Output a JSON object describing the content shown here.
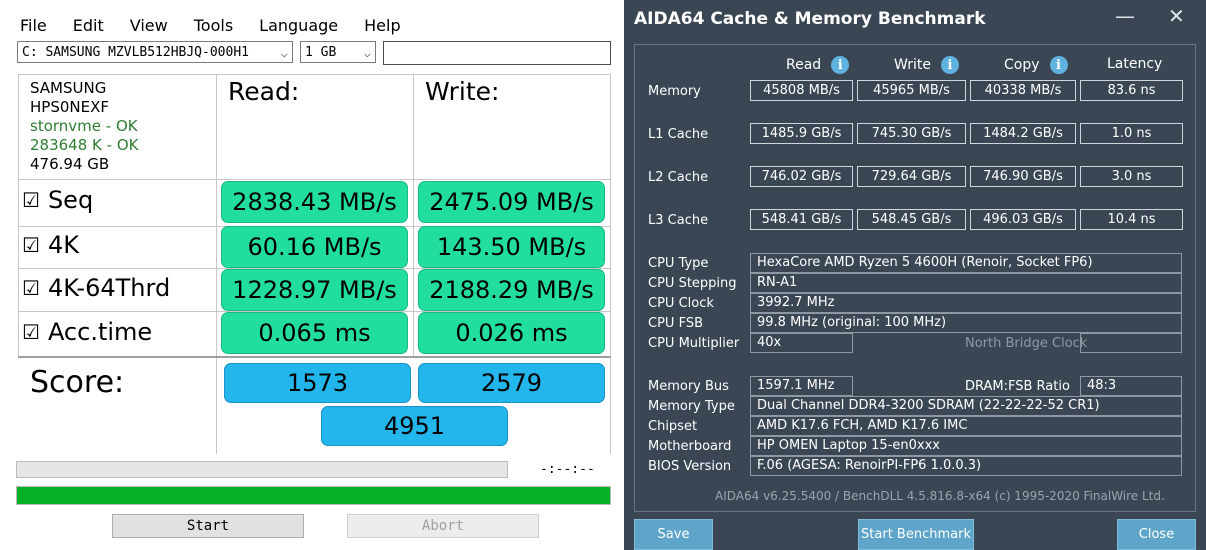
{
  "asssd": {
    "menu": [
      "File",
      "Edit",
      "View",
      "Tools",
      "Language",
      "Help"
    ],
    "drive_select": "C: SAMSUNG MZVLB512HBJQ-000H1",
    "size_select": "1 GB",
    "text_field": "",
    "drive_info": {
      "vendor": "SAMSUNG",
      "firmware": "HPS0NEXF",
      "driver": "stornvme - OK",
      "alignment": "283648 K - OK",
      "capacity": "476.94 GB"
    },
    "col_read": "Read:",
    "col_write": "Write:",
    "rows": [
      {
        "label": "Seq",
        "read": "2838.43 MB/s",
        "write": "2475.09 MB/s",
        "checked": true
      },
      {
        "label": "4K",
        "read": "60.16 MB/s",
        "write": "143.50 MB/s",
        "checked": true
      },
      {
        "label": "4K-64Thrd",
        "read": "1228.97 MB/s",
        "write": "2188.29 MB/s",
        "checked": true
      },
      {
        "label": "Acc.time",
        "read": "0.065 ms",
        "write": "0.026 ms",
        "checked": true
      }
    ],
    "check_glyph": "☑",
    "score_label": "Score:",
    "score_read": "1573",
    "score_write": "2579",
    "score_total": "4951",
    "elapsed": "-:--:--",
    "progress_fraction": 1.0,
    "start_label": "Start",
    "abort_label": "Abort"
  },
  "aida": {
    "title": "AIDA64 Cache & Memory Benchmark",
    "minimize_glyph": "—",
    "close_glyph": "✕",
    "info_glyph": "i",
    "headers": {
      "read": "Read",
      "write": "Write",
      "copy": "Copy",
      "latency": "Latency"
    },
    "bench_rows": [
      {
        "label": "Memory",
        "read": "45808 MB/s",
        "write": "45965 MB/s",
        "copy": "40338 MB/s",
        "latency": "83.6 ns"
      },
      {
        "label": "L1 Cache",
        "read": "1485.9 GB/s",
        "write": "745.30 GB/s",
        "copy": "1484.2 GB/s",
        "latency": "1.0 ns"
      },
      {
        "label": "L2 Cache",
        "read": "746.02 GB/s",
        "write": "729.64 GB/s",
        "copy": "746.90 GB/s",
        "latency": "3.0 ns"
      },
      {
        "label": "L3 Cache",
        "read": "548.41 GB/s",
        "write": "548.45 GB/s",
        "copy": "496.03 GB/s",
        "latency": "10.4 ns"
      }
    ],
    "cpu": {
      "type_label": "CPU Type",
      "type": "HexaCore AMD Ryzen 5 4600H  (Renoir, Socket FP6)",
      "stepping_label": "CPU Stepping",
      "stepping": "RN-A1",
      "clock_label": "CPU Clock",
      "clock": "3992.7 MHz",
      "fsb_label": "CPU FSB",
      "fsb": "99.8 MHz  (original: 100 MHz)",
      "multiplier_label": "CPU Multiplier",
      "multiplier": "40x",
      "nb_clock_label": "North Bridge Clock",
      "nb_clock": ""
    },
    "system": {
      "membus_label": "Memory Bus",
      "membus": "1597.1 MHz",
      "ratio_label": "DRAM:FSB Ratio",
      "ratio": "48:3",
      "memtype_label": "Memory Type",
      "memtype": "Dual Channel DDR4-3200 SDRAM  (22-22-22-52 CR1)",
      "chipset_label": "Chipset",
      "chipset": "AMD K17.6 FCH, AMD K17.6 IMC",
      "mobo_label": "Motherboard",
      "mobo": "HP OMEN Laptop 15-en0xxx",
      "bios_label": "BIOS Version",
      "bios": "F.06  (AGESA: RenoirPI-FP6 1.0.0.3)"
    },
    "footer": "AIDA64 v6.25.5400 / BenchDLL 4.5.816.8-x64  (c) 1995-2020 FinalWire Ltd.",
    "save_label": "Save",
    "start_label": "Start Benchmark",
    "close_label": "Close"
  }
}
